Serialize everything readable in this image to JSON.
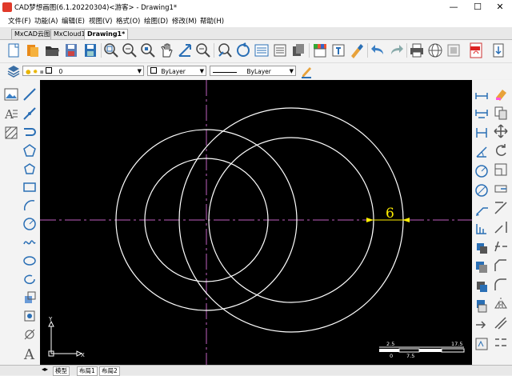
{
  "window": {
    "title": "CAD梦想画图(6.1.20220304)<游客> - Drawing1*",
    "minimize": "—",
    "maximize": "☐",
    "close": "✕"
  },
  "menu": [
    {
      "label": "文件(F)"
    },
    {
      "label": "功能(A)"
    },
    {
      "label": "编辑(E)"
    },
    {
      "label": "视图(V)"
    },
    {
      "label": "格式(O)"
    },
    {
      "label": "绘图(D)"
    },
    {
      "label": "修改(M)"
    },
    {
      "label": "帮助(H)"
    }
  ],
  "tabs": [
    {
      "label": "MxCAD云图",
      "active": false
    },
    {
      "label": "MxCloud1",
      "active": false
    },
    {
      "label": "Drawing1*",
      "active": true
    }
  ],
  "properties": {
    "layer": "0",
    "color": "ByLayer",
    "linetype": "ByLayer"
  },
  "drawing": {
    "dimension_text": "6",
    "scale_labels": [
      "2.5",
      "17.5",
      "0",
      "7.5"
    ],
    "ucs_x": "X",
    "ucs_y": "Y",
    "colors": {
      "background": "#000000",
      "lines": "#ffffff",
      "center": "#c060c0",
      "dimension": "#ffee00"
    }
  },
  "layout_tabs": [
    {
      "label": "模型"
    },
    {
      "label": "布局1"
    },
    {
      "label": "布局2"
    }
  ],
  "icons": {
    "toolbar": [
      "new-file-icon",
      "open-folder-icon",
      "open-file-icon",
      "save-icon",
      "save-as-icon",
      "zoom-window-icon",
      "zoom-out-icon",
      "zoom-extents-icon",
      "zoom-prev-icon",
      "pan-hand-icon",
      "orbit-icon",
      "move-arrow-icon",
      "zoom-realtime-icon",
      "undo-view-icon",
      "layer-manager-icon",
      "properties-icon",
      "blocks-icon",
      "print-preview-icon",
      "text-style-icon",
      "match-properties-icon",
      "undo-icon",
      "redo-icon",
      "print-icon",
      "web-icon",
      "cloud-icon",
      "pdf-icon",
      "import-icon"
    ]
  }
}
